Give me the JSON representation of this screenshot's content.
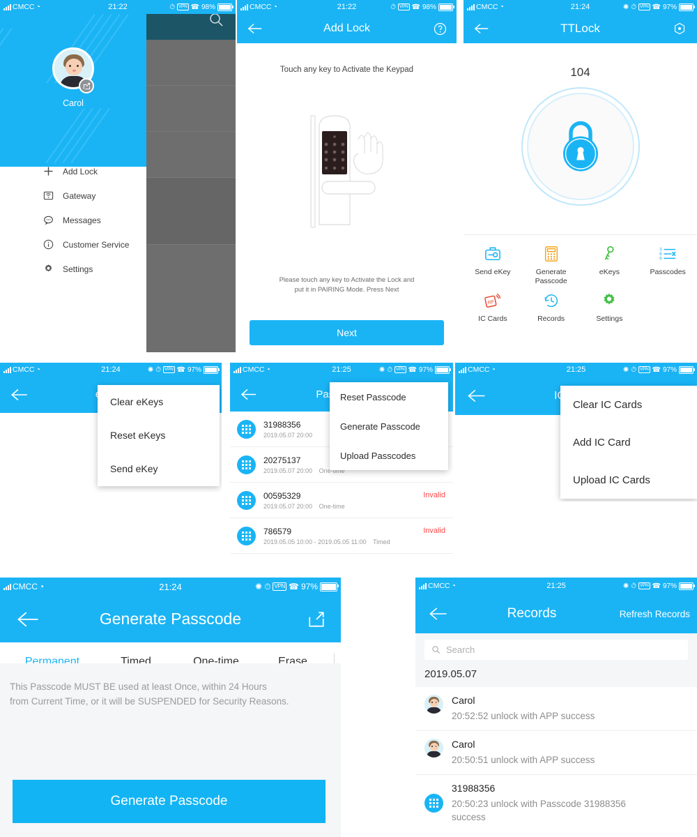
{
  "app": {
    "accent": "#1ab4f5",
    "invalid_color": "#ff4a4a"
  },
  "panel_drawer": {
    "status": {
      "carrier": "CMCC",
      "time": "21:22",
      "battery": "98%"
    },
    "user_name": "Carol",
    "menu": [
      {
        "icon": "plus-icon",
        "label": "Add Lock"
      },
      {
        "icon": "gateway-icon",
        "label": "Gateway"
      },
      {
        "icon": "message-icon",
        "label": "Messages"
      },
      {
        "icon": "info-icon",
        "label": "Customer Service"
      },
      {
        "icon": "gear-icon",
        "label": "Settings"
      }
    ]
  },
  "panel_add_lock": {
    "status": {
      "carrier": "CMCC",
      "time": "21:22",
      "battery": "98%"
    },
    "title": "Add Lock",
    "help_icon": "question-circle-icon",
    "hint": "Touch any key to Activate the Keypad",
    "note_line1": "Please touch any key to Activate the Lock and",
    "note_line2": "put it in PAIRING Mode. Press Next",
    "next_label": "Next"
  },
  "panel_ttlock": {
    "status": {
      "carrier": "CMCC",
      "time": "21:24",
      "battery": "97%"
    },
    "title": "TTLock",
    "right_icon": "settings-hex-icon",
    "room_number": "104",
    "lock_icon": "padlock-icon",
    "actions": [
      {
        "icon": "send-ekey-icon",
        "label": "Send eKey",
        "color": "#1ab4f5"
      },
      {
        "icon": "calculator-icon",
        "label": "Generate\nPasscode",
        "label1": "Generate",
        "label2": "Passcode",
        "color": "#f5a623"
      },
      {
        "icon": "key-icon",
        "label": "eKeys",
        "color": "#3fbf3f"
      },
      {
        "icon": "passcode-list-icon",
        "label": "Passcodes",
        "color": "#1ab4f5"
      },
      {
        "icon": "rf-card-icon",
        "label": "IC Cards",
        "color": "#e8452b"
      },
      {
        "icon": "clock-history-icon",
        "label": "Records",
        "color": "#1ab4f5"
      },
      {
        "icon": "gear-icon",
        "label": "Settings",
        "color": "#3fbf3f"
      }
    ]
  },
  "panel_ekeys": {
    "status": {
      "carrier": "CMCC",
      "time": "21:24",
      "battery": "97%"
    },
    "title": "eKeys",
    "menu": [
      "Clear eKeys",
      "Reset eKeys",
      "Send eKey"
    ]
  },
  "panel_passcodes": {
    "status": {
      "carrier": "CMCC",
      "time": "21:25",
      "battery": "97%"
    },
    "title": "Passcodes",
    "menu": [
      "Reset Passcode",
      "Generate Passcode",
      "Upload Passcodes"
    ],
    "rows": [
      {
        "code": "31988356",
        "date": "2019.05.07 20:00",
        "type": "",
        "status": ""
      },
      {
        "code": "20275137",
        "date": "2019.05.07 20:00",
        "type": "One-time",
        "status": ""
      },
      {
        "code": "00595329",
        "date": "2019.05.07 20:00",
        "type": "One-time",
        "status": "Invalid"
      },
      {
        "code": "786579",
        "date": "2019.05.05 10:00 - 2019.05.05 11:00",
        "type": "Timed",
        "status": "Invalid"
      }
    ]
  },
  "panel_ic_cards": {
    "status": {
      "carrier": "CMCC",
      "time": "21:25",
      "battery": "97%"
    },
    "title": "IC Cards",
    "menu": [
      "Clear IC Cards",
      "Add IC Card",
      "Upload IC Cards"
    ]
  },
  "panel_generate_passcode": {
    "status": {
      "carrier": "CMCC",
      "time": "21:24",
      "battery": "97%"
    },
    "title": "Generate Passcode",
    "share_icon": "share-external-icon",
    "tabs": [
      {
        "label": "Permanent",
        "active": true
      },
      {
        "label": "Timed",
        "active": false
      },
      {
        "label": "One-time",
        "active": false
      },
      {
        "label": "Erase",
        "active": false
      }
    ],
    "warning_line1": "This Passcode MUST BE used at least Once, within 24 Hours",
    "warning_line2": "from Current Time, or it will be SUSPENDED for Security Reasons.",
    "button_label": "Generate Passcode"
  },
  "panel_records": {
    "status": {
      "carrier": "CMCC",
      "time": "21:25",
      "battery": "97%"
    },
    "title": "Records",
    "refresh_label": "Refresh Records",
    "search_placeholder": "Search",
    "date_header": "2019.05.07",
    "items": [
      {
        "avatar": "user",
        "name": "Carol",
        "desc": "20:52:52 unlock with APP success"
      },
      {
        "avatar": "user",
        "name": "Carol",
        "desc": "20:50:51 unlock with APP success"
      },
      {
        "avatar": "keypad",
        "name": "31988356",
        "desc": "20:50:23 unlock with Passcode 31988356 success"
      }
    ]
  }
}
